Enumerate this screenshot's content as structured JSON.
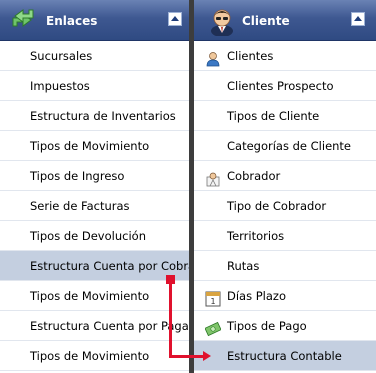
{
  "left_panel": {
    "title": "Enlaces",
    "icon": "sync-arrows-icon",
    "items": [
      {
        "label": "Sucursales"
      },
      {
        "label": "Impuestos"
      },
      {
        "label": "Estructura de Inventarios"
      },
      {
        "label": "Tipos de Movimiento"
      },
      {
        "label": "Tipos de Ingreso"
      },
      {
        "label": "Serie de Facturas"
      },
      {
        "label": "Tipos de Devolución"
      },
      {
        "label": "Estructura Cuenta por Cobrar",
        "selected": true
      },
      {
        "label": "Tipos de Movimiento"
      },
      {
        "label": "Estructura Cuenta por Pagar"
      },
      {
        "label": "Tipos de Movimiento"
      }
    ]
  },
  "right_panel": {
    "title": "Cliente",
    "icon": "client-avatar-icon",
    "items": [
      {
        "label": "Clientes",
        "icon": "user-icon"
      },
      {
        "label": "Clientes Prospecto"
      },
      {
        "label": "Tipos de Cliente"
      },
      {
        "label": "Categorías de Cliente"
      },
      {
        "label": "Cobrador",
        "icon": "collector-icon"
      },
      {
        "label": "Tipo de Cobrador"
      },
      {
        "label": "Territorios"
      },
      {
        "label": "Rutas"
      },
      {
        "label": "Días Plazo",
        "icon": "calendar-icon"
      },
      {
        "label": "Tipos de Pago",
        "icon": "money-icon"
      },
      {
        "label": "Estructura Contable",
        "selected": true
      }
    ]
  },
  "connector": {
    "color": "#e0112d",
    "from": "Estructura Cuenta por Cobrar",
    "to": "Estructura Contable"
  }
}
